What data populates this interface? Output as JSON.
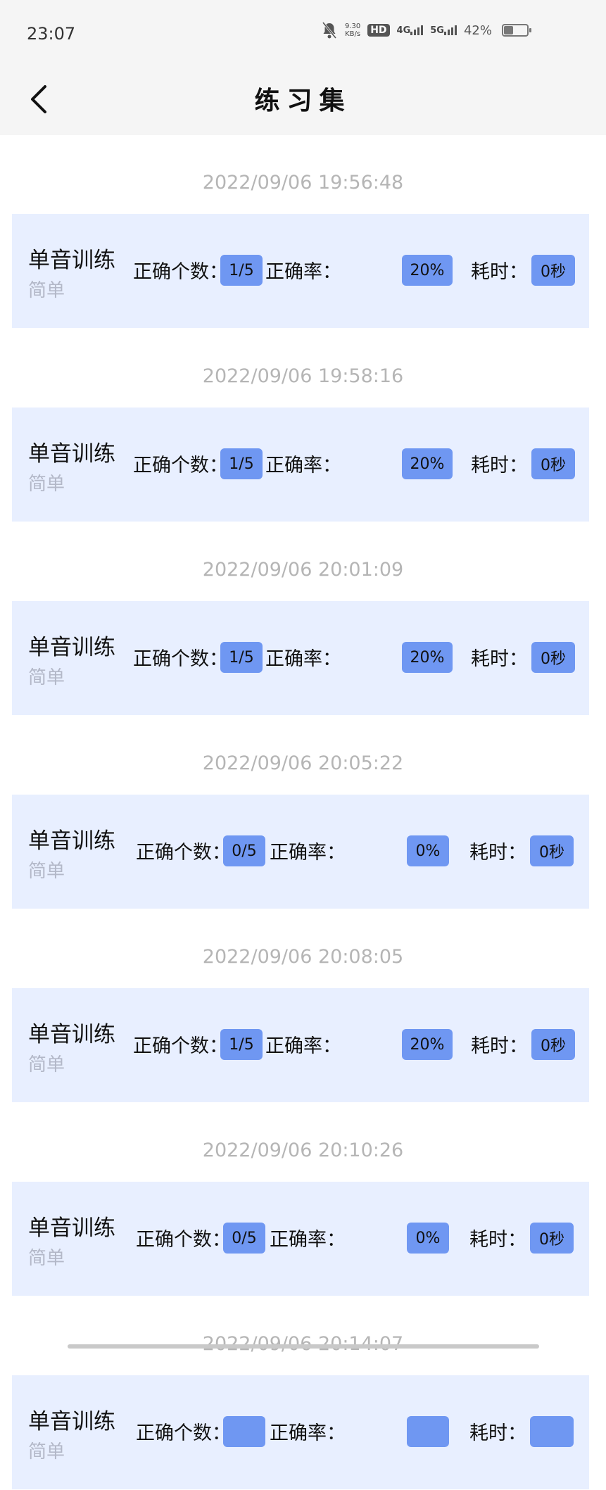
{
  "status_bar": {
    "time": "23:07",
    "net_speed_value": "9.30",
    "net_speed_unit": "KB/s",
    "hd_label": "HD",
    "network_4g": "4G",
    "network_5g": "5G",
    "battery_percent": "42%",
    "battery_level": 0.42,
    "icons": [
      "bell-off-icon",
      "hd-icon",
      "signal-4g-icon",
      "signal-5g-icon",
      "battery-icon"
    ]
  },
  "header": {
    "title": "练习集",
    "back_icon": "chevron-left-icon"
  },
  "records": [
    {
      "timestamp": "2022/09/06 19:56:48",
      "name": "单音训练",
      "level": "简单",
      "correct_label": "正确个数：",
      "correct": "1/5",
      "rate_label": "正确率：",
      "rate": "20%",
      "time_label": "耗时：",
      "duration": "0秒"
    },
    {
      "timestamp": "2022/09/06 19:58:16",
      "name": "单音训练",
      "level": "简单",
      "correct_label": "正确个数：",
      "correct": "1/5",
      "rate_label": "正确率：",
      "rate": "20%",
      "time_label": "耗时：",
      "duration": "0秒"
    },
    {
      "timestamp": "2022/09/06 20:01:09",
      "name": "单音训练",
      "level": "简单",
      "correct_label": "正确个数：",
      "correct": "1/5",
      "rate_label": "正确率：",
      "rate": "20%",
      "time_label": "耗时：",
      "duration": "0秒"
    },
    {
      "timestamp": "2022/09/06 20:05:22",
      "name": "单音训练",
      "level": "简单",
      "correct_label": "正确个数：",
      "correct": "0/5",
      "rate_label": "正确率：",
      "rate": "0%",
      "time_label": "耗时：",
      "duration": "0秒"
    },
    {
      "timestamp": "2022/09/06 20:08:05",
      "name": "单音训练",
      "level": "简单",
      "correct_label": "正确个数：",
      "correct": "1/5",
      "rate_label": "正确率：",
      "rate": "20%",
      "time_label": "耗时：",
      "duration": "0秒"
    },
    {
      "timestamp": "2022/09/06 20:10:26",
      "name": "单音训练",
      "level": "简单",
      "correct_label": "正确个数：",
      "correct": "0/5",
      "rate_label": "正确率：",
      "rate": "0%",
      "time_label": "耗时：",
      "duration": "0秒"
    },
    {
      "timestamp": "2022/09/06 20:14:07",
      "name": "单音训练",
      "level": "简单",
      "correct_label": "正确个数：",
      "correct": "",
      "rate_label": "正确率：",
      "rate": "",
      "time_label": "耗时：",
      "duration": ""
    }
  ],
  "colors": {
    "badge": "#6f97f2",
    "card_bg": "#e8efff",
    "timestamp": "#b5b5b5",
    "level": "#b3b8c8"
  }
}
